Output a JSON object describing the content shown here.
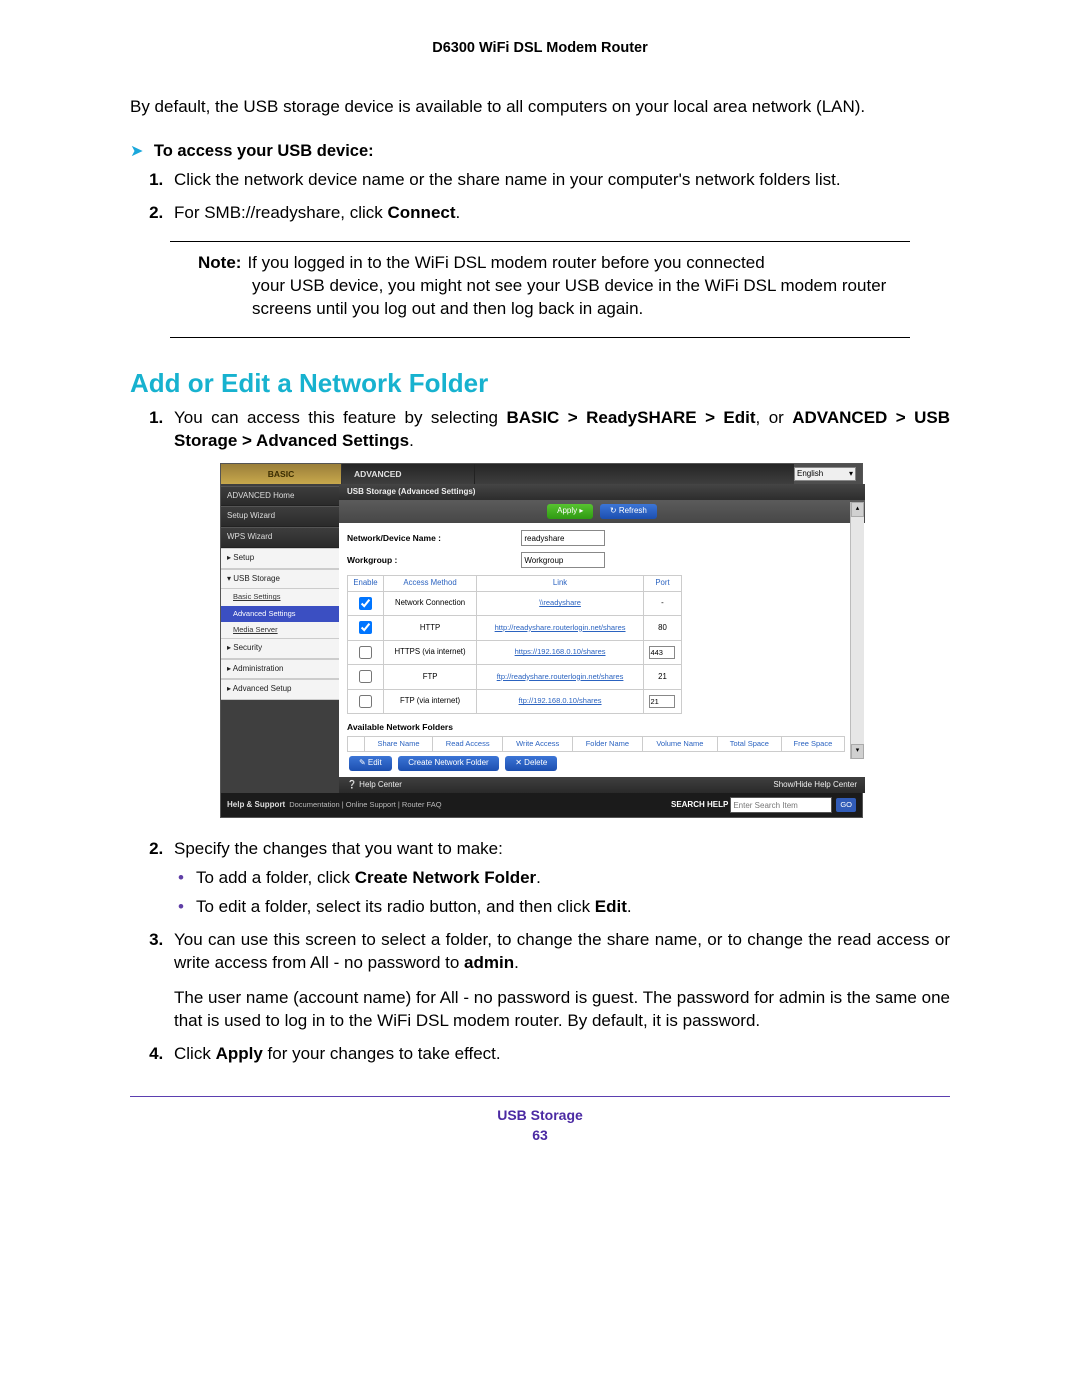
{
  "header": {
    "title": "D6300 WiFi DSL Modem Router"
  },
  "intro": "By default, the USB storage device is available to all computers on your local area network (LAN).",
  "proc1": {
    "arrow": "➤",
    "title": "To access your USB device:",
    "steps1a": "Click the network device name or the share name in your computer's network folders list.",
    "steps1b_pre": "For SMB://readyshare, click ",
    "steps1b_bold": "Connect",
    "steps1b_post": "."
  },
  "note": {
    "label": "Note:",
    "line1": "If you logged in to the WiFi DSL modem router before you connected",
    "rest": "your USB device, you might not see your USB device in the WiFi DSL modem router screens until you log out and then log back in again."
  },
  "section_title": "Add or Edit a Network Folder",
  "step1": {
    "pre": "You can access this feature by selecting ",
    "b1": "BASIC > ReadySHARE > Edit",
    "mid": ", or ",
    "b2": "ADVANCED > USB Storage > Advanced Settings",
    "post": "."
  },
  "screenshot": {
    "tabs": {
      "basic": "BASIC",
      "advanced": "ADVANCED"
    },
    "lang": "English",
    "side": {
      "home": "ADVANCED Home",
      "setup_wiz": "Setup Wizard",
      "wps_wiz": "WPS Wizard",
      "setup": "▸ Setup",
      "usb": "▾ USB Storage",
      "sub_basic": "Basic Settings",
      "sub_adv": "Advanced Settings",
      "sub_media": "Media Server",
      "security": "▸ Security",
      "admin": "▸ Administration",
      "advsetup": "▸ Advanced Setup"
    },
    "panel_title": "USB Storage (Advanced Settings)",
    "btn_apply": "Apply ▸",
    "btn_refresh": "↻ Refresh",
    "form": {
      "dev_label": "Network/Device Name :",
      "dev_value": "readyshare",
      "wg_label": "Workgroup :",
      "wg_value": "Workgroup"
    },
    "tbl": {
      "h_enable": "Enable",
      "h_access": "Access Method",
      "h_link": "Link",
      "h_port": "Port",
      "rows": [
        {
          "enabled": true,
          "method": "Network Connection",
          "link": "\\\\readyshare",
          "port": "-",
          "port_input": false
        },
        {
          "enabled": true,
          "method": "HTTP",
          "link": "http://readyshare.routerlogin.net/shares",
          "port": "80",
          "port_input": false
        },
        {
          "enabled": false,
          "method": "HTTPS (via internet)",
          "link": "https://192.168.0.10/shares",
          "port": "443",
          "port_input": true
        },
        {
          "enabled": false,
          "method": "FTP",
          "link": "ftp://readyshare.routerlogin.net/shares",
          "port": "21",
          "port_input": false
        },
        {
          "enabled": false,
          "method": "FTP (via internet)",
          "link": "ftp://192.168.0.10/shares",
          "port": "21",
          "port_input": true
        }
      ]
    },
    "avail_title": "Available Network Folders",
    "avail_headers": [
      "Share Name",
      "Read Access",
      "Write Access",
      "Folder Name",
      "Volume Name",
      "Total Space",
      "Free Space"
    ],
    "btn_edit": "✎ Edit",
    "btn_create": "Create Network Folder",
    "btn_delete": "✕ Delete",
    "help": {
      "left": "❔ Help Center",
      "right": "Show/Hide Help Center"
    },
    "footer": {
      "hs": "Help & Support",
      "links": "Documentation | Online Support | Router FAQ",
      "search_lbl": "SEARCH HELP",
      "search_ph": "Enter Search Item",
      "go": "GO"
    }
  },
  "step2": {
    "lead": "Specify the changes that you want to make:",
    "bul1_pre": "To add a folder, click ",
    "bul1_b": "Create Network Folder",
    "bul1_post": ".",
    "bul2_pre": "To edit a folder, select its radio button, and then click ",
    "bul2_b": "Edit",
    "bul2_post": "."
  },
  "step3": {
    "p1_pre": "You can use this screen to select a folder, to change the share name, or to change the read access or write access from All - no password to ",
    "p1_b": "admin",
    "p1_post": ".",
    "p2": "The user name (account name) for All - no password is guest. The password for admin is the same one that is used to log in to the WiFi DSL modem router. By default, it is password."
  },
  "step4": {
    "pre": "Click ",
    "b": "Apply",
    "post": " for your changes to take effect."
  },
  "page_footer": {
    "section": "USB Storage",
    "page": "63"
  }
}
